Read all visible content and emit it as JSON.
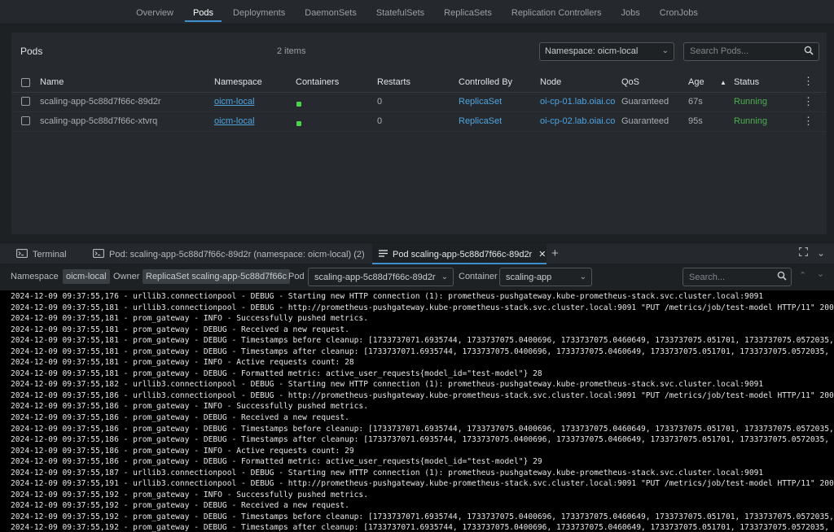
{
  "nav": {
    "tabs": [
      "Overview",
      "Pods",
      "Deployments",
      "DaemonSets",
      "StatefulSets",
      "ReplicaSets",
      "Replication Controllers",
      "Jobs",
      "CronJobs"
    ],
    "active": "Pods"
  },
  "pods": {
    "title": "Pods",
    "count": "2 items",
    "namespace_select": "Namespace: oicm-local",
    "search_placeholder": "Search Pods...",
    "columns": {
      "name": "Name",
      "namespace": "Namespace",
      "containers": "Containers",
      "restarts": "Restarts",
      "controlled_by": "Controlled By",
      "node": "Node",
      "qos": "QoS",
      "age": "Age",
      "status": "Status"
    },
    "rows": [
      {
        "name": "scaling-app-5c88d7f66c-89d2r",
        "namespace": "oicm-local",
        "restarts": "0",
        "controlled_by": "ReplicaSet",
        "node": "oi-cp-01.lab.oiai.co",
        "qos": "Guaranteed",
        "age": "67s",
        "status": "Running"
      },
      {
        "name": "scaling-app-5c88d7f66c-xtvrq",
        "namespace": "oicm-local",
        "restarts": "0",
        "controlled_by": "ReplicaSet",
        "node": "oi-cp-02.lab.oiai.co",
        "qos": "Guaranteed",
        "age": "95s",
        "status": "Running"
      }
    ]
  },
  "dock": {
    "tabs": [
      {
        "label": "Terminal",
        "icon": "terminal-icon"
      },
      {
        "label": "Pod: scaling-app-5c88d7f66c-89d2r (namespace: oicm-local) (2)",
        "icon": "terminal-icon"
      },
      {
        "label": "Pod scaling-app-5c88d7f66c-89d2r",
        "icon": "log-icon"
      }
    ],
    "active_index": 2
  },
  "filters": {
    "namespace_label": "Namespace",
    "namespace_value": "oicm-local",
    "owner_label": "Owner",
    "owner_value": "ReplicaSet scaling-app-5c88d7f66c",
    "pod_label": "Pod",
    "pod_value": "scaling-app-5c88d7f66c-89d2r",
    "container_label": "Container",
    "container_value": "scaling-app",
    "search_placeholder": "Search..."
  },
  "log_lines": [
    "2024-12-09 09:37:55,176 - urllib3.connectionpool - DEBUG - Starting new HTTP connection (1): prometheus-pushgateway.kube-prometheus-stack.svc.cluster.local:9091",
    "2024-12-09 09:37:55,181 - urllib3.connectionpool - DEBUG - http://prometheus-pushgateway.kube-prometheus-stack.svc.cluster.local:9091 \"PUT /metrics/job/test-model HTTP/11\" 200 0",
    "2024-12-09 09:37:55,181 - prom_gateway - INFO - Successfully pushed metrics.",
    "2024-12-09 09:37:55,181 - prom_gateway - DEBUG - Received a new request.",
    "2024-12-09 09:37:55,181 - prom_gateway - DEBUG - Timestamps before cleanup: [1733737071.6935744, 1733737075.0400696, 1733737075.0460649, 1733737075.051701, 1733737075.0572035, 1733737075.06278",
    "2024-12-09 09:37:55,181 - prom_gateway - DEBUG - Timestamps after cleanup: [1733737071.6935744, 1733737075.0400696, 1733737075.0460649, 1733737075.051701, 1733737075.0572035, 1733737075.062784",
    "2024-12-09 09:37:55,181 - prom_gateway - INFO - Active requests count: 28",
    "2024-12-09 09:37:55,181 - prom_gateway - DEBUG - Formatted metric: active_user_requests{model_id=\"test-model\"} 28",
    "2024-12-09 09:37:55,182 - urllib3.connectionpool - DEBUG - Starting new HTTP connection (1): prometheus-pushgateway.kube-prometheus-stack.svc.cluster.local:9091",
    "2024-12-09 09:37:55,186 - urllib3.connectionpool - DEBUG - http://prometheus-pushgateway.kube-prometheus-stack.svc.cluster.local:9091 \"PUT /metrics/job/test-model HTTP/11\" 200 0",
    "2024-12-09 09:37:55,186 - prom_gateway - INFO - Successfully pushed metrics.",
    "2024-12-09 09:37:55,186 - prom_gateway - DEBUG - Received a new request.",
    "2024-12-09 09:37:55,186 - prom_gateway - DEBUG - Timestamps before cleanup: [1733737071.6935744, 1733737075.0400696, 1733737075.0460649, 1733737075.051701, 1733737075.0572035, 1733737075.06278",
    "2024-12-09 09:37:55,186 - prom_gateway - DEBUG - Timestamps after cleanup: [1733737071.6935744, 1733737075.0400696, 1733737075.0460649, 1733737075.051701, 1733737075.0572035, 1733737075.062784",
    "2024-12-09 09:37:55,186 - prom_gateway - INFO - Active requests count: 29",
    "2024-12-09 09:37:55,186 - prom_gateway - DEBUG - Formatted metric: active_user_requests{model_id=\"test-model\"} 29",
    "2024-12-09 09:37:55,187 - urllib3.connectionpool - DEBUG - Starting new HTTP connection (1): prometheus-pushgateway.kube-prometheus-stack.svc.cluster.local:9091",
    "2024-12-09 09:37:55,191 - urllib3.connectionpool - DEBUG - http://prometheus-pushgateway.kube-prometheus-stack.svc.cluster.local:9091 \"PUT /metrics/job/test-model HTTP/11\" 200 0",
    "2024-12-09 09:37:55,192 - prom_gateway - INFO - Successfully pushed metrics.",
    "2024-12-09 09:37:55,192 - prom_gateway - DEBUG - Received a new request.",
    "2024-12-09 09:37:55,192 - prom_gateway - DEBUG - Timestamps before cleanup: [1733737071.6935744, 1733737075.0400696, 1733737075.0460649, 1733737075.051701, 1733737075.0572035, 1733737075.06278",
    "2024-12-09 09:37:55,192 - prom_gateway - DEBUG - Timestamps after cleanup: [1733737071.6935744, 1733737075.0400696, 1733737075.0460649, 1733737075.051701, 1733737075.0572035, 1733737075.062784"
  ]
}
